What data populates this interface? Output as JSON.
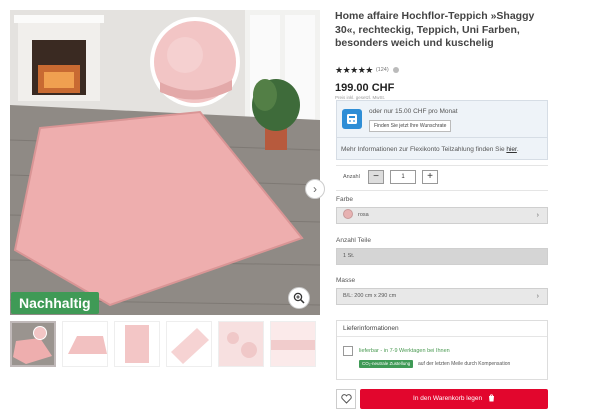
{
  "product": {
    "title": "Home affaire Hochflor-Teppich »Shaggy 30«, rechteckig, Teppich, Uni Farben, besonders weich und kuschelig",
    "stars": "★★★★★",
    "rating_count": "(124)",
    "price": "199.00 CHF",
    "price_note": "Preis inkl. gesetzl. MwSt."
  },
  "gallery": {
    "badge": "Nachhaltig",
    "thumbnail_count": 6
  },
  "finance": {
    "monthly_text": "oder nur 15.00 CHF pro Monat",
    "button_label": "Finden Sie jetzt Ihre Wunschrate",
    "more_text": "Mehr Informationen zur Flexikonto Teilzahlung finden Sie",
    "more_link": "hier",
    "more_suffix": "."
  },
  "quantity": {
    "label": "Anzahl",
    "minus": "−",
    "plus": "+",
    "value": "1"
  },
  "color": {
    "label": "Farbe",
    "value": "rosa",
    "swatch_hex": "#e7b2b2"
  },
  "parts": {
    "label": "Anzahl Teile",
    "value": "1 St."
  },
  "size": {
    "label": "Masse",
    "value": "B/L: 200 cm x 290 cm"
  },
  "delivery": {
    "title": "Lieferinformationen",
    "status": "lieferbar - in 7-9 Werktagen bei Ihnen",
    "co2_badge": "CO₂-neutrale Zustellung",
    "co2_text": "auf der letzten Meile durch Kompensation"
  },
  "cart": {
    "label": "In den Warenkorb legen"
  },
  "colors": {
    "accent_red": "#e2062d",
    "sustainable_green": "#3f9a56",
    "finance_blue": "#2f8ed6"
  }
}
